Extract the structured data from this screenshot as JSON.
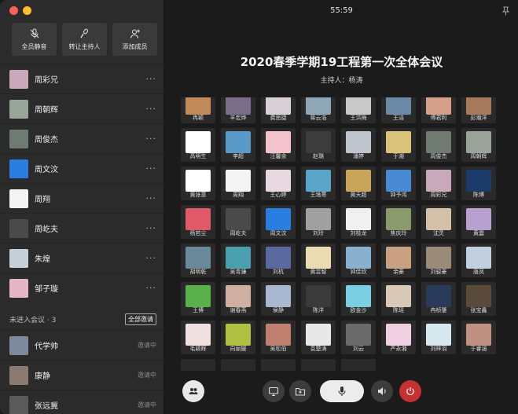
{
  "meeting": {
    "timer": "55:59",
    "title": "2020春季学期19工程第一次全体会议",
    "host": "主持人：杨涛"
  },
  "actions": [
    {
      "label": "全员静音",
      "icon": "mic-mute-icon"
    },
    {
      "label": "转让主持人",
      "icon": "mic-host-icon"
    },
    {
      "label": "添加成员",
      "icon": "add-user-icon"
    }
  ],
  "members": [
    {
      "name": "周彩兄",
      "color": "#c9a8b9"
    },
    {
      "name": "周朝辉",
      "color": "#9aa59a"
    },
    {
      "name": "周俊杰",
      "color": "#6f7b70"
    },
    {
      "name": "周文汶",
      "color": "#2a7de1"
    },
    {
      "name": "周翔",
      "color": "#f4f4f4"
    },
    {
      "name": "周屹夫",
      "color": "#4a4a4a"
    },
    {
      "name": "朱煌",
      "color": "#c7cfd6"
    },
    {
      "name": "邹子璇",
      "color": "#e5b7c6"
    }
  ],
  "more_label": "···",
  "not_joined": {
    "header": "未进入会议 · 3",
    "invite_all": "全部邀请",
    "items": [
      {
        "name": "代学帅",
        "status": "邀请中",
        "color": "#7d8a9b"
      },
      {
        "name": "康静",
        "status": "邀请中",
        "color": "#8a7a70"
      },
      {
        "name": "张远冀",
        "status": "邀请中",
        "color": "#5a5a5a"
      }
    ]
  },
  "grid_tiles": [
    {
      "name": "冉颖",
      "color": "#c08a5a"
    },
    {
      "name": "羊宏烨",
      "color": "#7a6d8a"
    },
    {
      "name": "费思捷",
      "color": "#d9d0d6"
    },
    {
      "name": "蒋云浩",
      "color": "#8fa6b6"
    },
    {
      "name": "王洪梅",
      "color": "#c9c9c9"
    },
    {
      "name": "王洁",
      "color": "#6a8aa8"
    },
    {
      "name": "傅君利",
      "color": "#d4a08a"
    },
    {
      "name": "彭瀚洋",
      "color": "#a67a5a"
    },
    {
      "name": "高明生",
      "color": "#ffffff"
    },
    {
      "name": "李超",
      "color": "#5a9ac9"
    },
    {
      "name": "汪馨余",
      "color": "#f2c4c9"
    },
    {
      "name": "赵璐",
      "color": "#3c3c3c"
    },
    {
      "name": "潘婷",
      "color": "#bfc5cc"
    },
    {
      "name": "于湘",
      "color": "#d9c27a"
    },
    {
      "name": "周俊杰",
      "color": "#6f7b70"
    },
    {
      "name": "周朝辉",
      "color": "#9aa59a"
    },
    {
      "name": "黄张意",
      "color": "#ffffff"
    },
    {
      "name": "周翔",
      "color": "#f4f4f4"
    },
    {
      "name": "王心婷",
      "color": "#e8d9e0"
    },
    {
      "name": "王逸寒",
      "color": "#5aa6c9"
    },
    {
      "name": "黄天超",
      "color": "#c9a55a"
    },
    {
      "name": "钟予鸿",
      "color": "#4a8ad4"
    },
    {
      "name": "周彩兄",
      "color": "#c9a8b9"
    },
    {
      "name": "陈博",
      "color": "#1a3a6a"
    },
    {
      "name": "杨若尘",
      "color": "#e05a6a"
    },
    {
      "name": "周屹夫",
      "color": "#4a4a4a"
    },
    {
      "name": "周文汶",
      "color": "#2a7de1"
    },
    {
      "name": "刘玲",
      "color": "#a0a0a0"
    },
    {
      "name": "刘枝龙",
      "color": "#f0f0f0"
    },
    {
      "name": "焦庆玲",
      "color": "#8a9a6a"
    },
    {
      "name": "沈灵",
      "color": "#d4c0a8"
    },
    {
      "name": "黄震",
      "color": "#b8a0d0"
    },
    {
      "name": "胡明乾",
      "color": "#6a8a9a"
    },
    {
      "name": "吴青濂",
      "color": "#4aa0b0"
    },
    {
      "name": "刘杭",
      "color": "#5a6aa0"
    },
    {
      "name": "黄昱智",
      "color": "#e8dcb0"
    },
    {
      "name": "钟佳欣",
      "color": "#8ab0d0"
    },
    {
      "name": "余豪",
      "color": "#c9a080"
    },
    {
      "name": "刘骏豪",
      "color": "#9a8a7a"
    },
    {
      "name": "唐凤",
      "color": "#c0d0e0"
    },
    {
      "name": "王博",
      "color": "#5ab04a"
    },
    {
      "name": "谢春燕",
      "color": "#d0b0a0"
    },
    {
      "name": "侯静",
      "color": "#a8b8d0"
    },
    {
      "name": "陈洋",
      "color": "#3a3a3a"
    },
    {
      "name": "欧金沙",
      "color": "#7ad0e0"
    },
    {
      "name": "陈瑶",
      "color": "#d8c8b8"
    },
    {
      "name": "冉桢肇",
      "color": "#2a3a5a"
    },
    {
      "name": "张宝鑫",
      "color": "#5a4a3a"
    },
    {
      "name": "毛颖辉",
      "color": "#f0e0e0"
    },
    {
      "name": "向丽媛",
      "color": "#b0c040"
    },
    {
      "name": "吴松伯",
      "color": "#c08070"
    },
    {
      "name": "袁楚涛",
      "color": "#e8e8e8"
    },
    {
      "name": "刘云",
      "color": "#6a6a6a"
    },
    {
      "name": "严永湘",
      "color": "#f0d0e0"
    },
    {
      "name": "刘梓羽",
      "color": "#d8e8f0"
    },
    {
      "name": "于睿涵",
      "color": "#c09080"
    }
  ]
}
